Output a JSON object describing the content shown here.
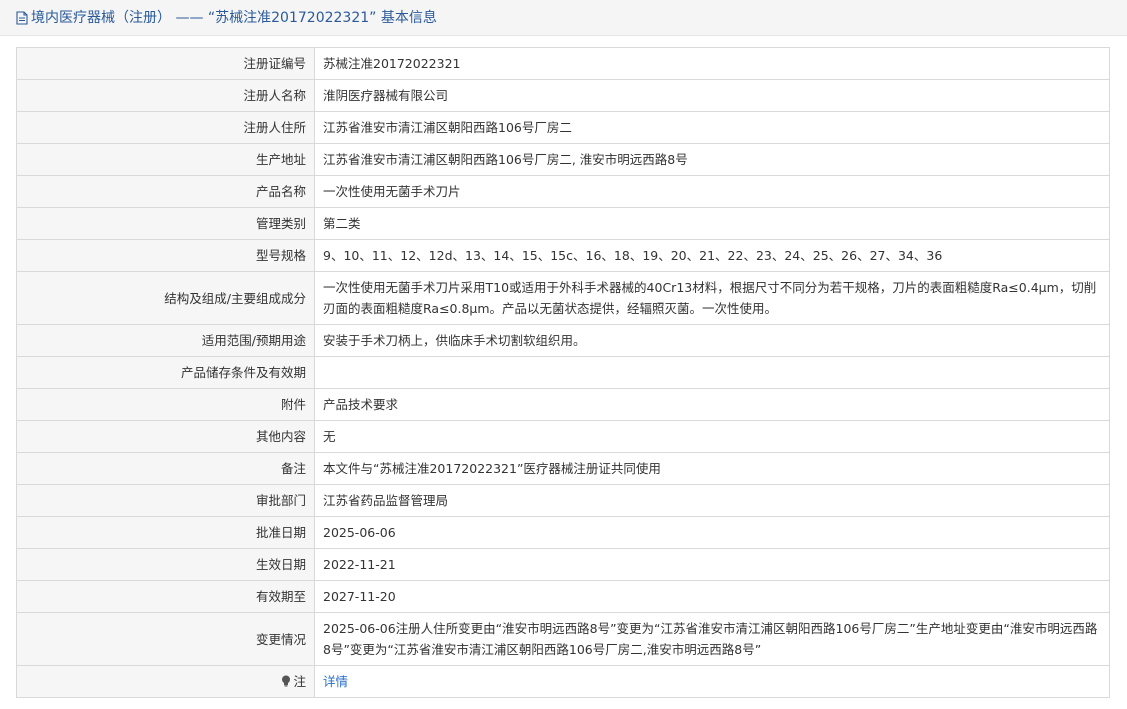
{
  "header": {
    "title": "境内医疗器械（注册） —— “苏械注准20172022321” 基本信息"
  },
  "rows": [
    {
      "label": "注册证编号",
      "value": "苏械注准20172022321"
    },
    {
      "label": "注册人名称",
      "value": "淮阴医疗器械有限公司"
    },
    {
      "label": "注册人住所",
      "value": "江苏省淮安市清江浦区朝阳西路106号厂房二"
    },
    {
      "label": "生产地址",
      "value": "江苏省淮安市清江浦区朝阳西路106号厂房二, 淮安市明远西路8号"
    },
    {
      "label": "产品名称",
      "value": "一次性使用无菌手术刀片"
    },
    {
      "label": "管理类别",
      "value": "第二类"
    },
    {
      "label": "型号规格",
      "value": "9、10、11、12、12d、13、14、15、15c、16、18、19、20、21、22、23、24、25、26、27、34、36"
    },
    {
      "label": "结构及组成/主要组成成分",
      "value": "一次性使用无菌手术刀片采用T10或适用于外科手术器械的40Cr13材料，根据尺寸不同分为若干规格，刀片的表面粗糙度Ra≤0.4μm，切削刃面的表面粗糙度Ra≤0.8μm。产品以无菌状态提供，经辐照灭菌。一次性使用。"
    },
    {
      "label": "适用范围/预期用途",
      "value": "安装于手术刀柄上，供临床手术切割软组织用。"
    },
    {
      "label": "产品储存条件及有效期",
      "value": ""
    },
    {
      "label": "附件",
      "value": "产品技术要求"
    },
    {
      "label": "其他内容",
      "value": "无"
    },
    {
      "label": "备注",
      "value": "本文件与“苏械注准20172022321”医疗器械注册证共同使用"
    },
    {
      "label": "审批部门",
      "value": "江苏省药品监督管理局"
    },
    {
      "label": "批准日期",
      "value": "2025-06-06"
    },
    {
      "label": "生效日期",
      "value": "2022-11-21"
    },
    {
      "label": "有效期至",
      "value": "2027-11-20"
    },
    {
      "label": "变更情况",
      "value": "2025-06-06注册人住所变更由“淮安市明远西路8号”变更为“江苏省淮安市清江浦区朝阳西路106号厂房二”生产地址变更由“淮安市明远西路8号”变更为“江苏省淮安市清江浦区朝阳西路106号厂房二,淮安市明远西路8号”"
    },
    {
      "label": "注",
      "value": "详情"
    }
  ],
  "icons": {
    "header_icon": "document-icon",
    "note_icon": "lightbulb-icon"
  },
  "colors": {
    "title": "#2a5a9a",
    "link": "#2a6ec8",
    "label_bg": "#f6f6f6",
    "border": "#d9d9d9"
  }
}
